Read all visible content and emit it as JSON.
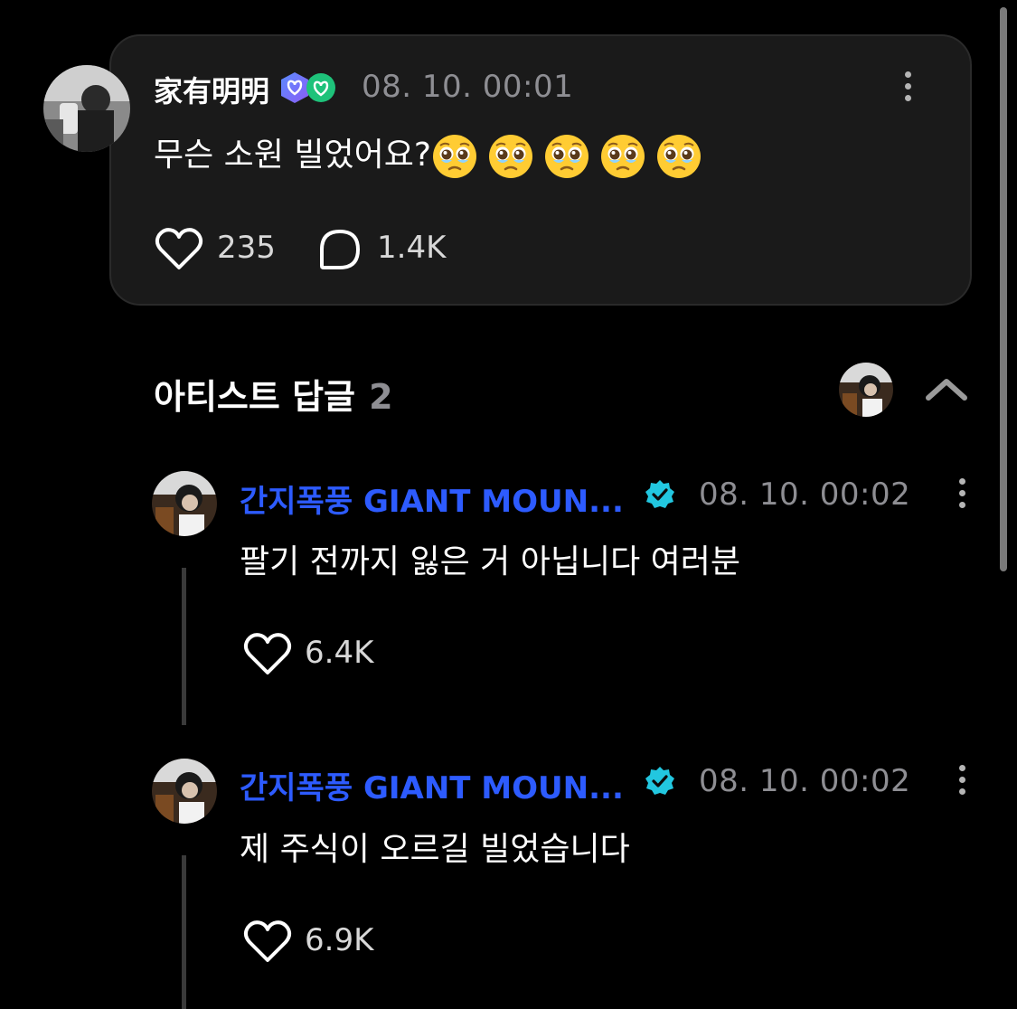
{
  "post": {
    "author": "家有明明",
    "timestamp": "08. 10. 00:01",
    "text": "무슨 소원 빌었어요?",
    "emoji_count": 5,
    "emoji": "pleading-face-emoji",
    "likes": "235",
    "comments": "1.4K"
  },
  "artist_replies": {
    "title": "아티스트 답글",
    "count": "2"
  },
  "replies": [
    {
      "author": "간지폭풍 GIANT MOUN...",
      "timestamp": "08. 10. 00:02",
      "text": "팔기 전까지 잃은 거 아닙니다 여러분",
      "likes": "6.4K"
    },
    {
      "author": "간지폭풍 GIANT MOUN...",
      "timestamp": "08. 10. 00:02",
      "text": "제 주식이 오르길 빌었습니다",
      "likes": "6.9K"
    }
  ],
  "colors": {
    "background": "#000000",
    "card": "#1a1a1a",
    "artist_name": "#2d5bff",
    "verified_badge": "#22c7e0",
    "muted_text": "#8e8e93"
  },
  "icons": [
    "heart-icon",
    "comment-bubble-icon",
    "more-vertical-icon",
    "chevron-up-icon",
    "verified-badge-icon",
    "membership-badge-icon"
  ]
}
